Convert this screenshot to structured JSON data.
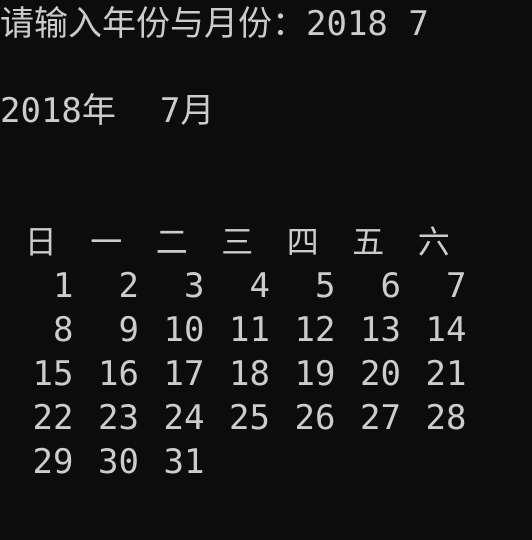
{
  "prompt": {
    "label": "请输入年份与月份：",
    "value": "2018 7"
  },
  "header": {
    "year": "2018年",
    "month": "7月"
  },
  "rule": "______________________",
  "weekdays": [
    "日",
    "一",
    "二",
    "三",
    "四",
    "五",
    "六"
  ],
  "weeks": [
    [
      "1",
      "2",
      "3",
      "4",
      "5",
      "6",
      "7"
    ],
    [
      "8",
      "9",
      "10",
      "11",
      "12",
      "13",
      "14"
    ],
    [
      "15",
      "16",
      "17",
      "18",
      "19",
      "20",
      "21"
    ],
    [
      "22",
      "23",
      "24",
      "25",
      "26",
      "27",
      "28"
    ],
    [
      "29",
      "30",
      "31",
      "",
      "",
      "",
      ""
    ]
  ]
}
